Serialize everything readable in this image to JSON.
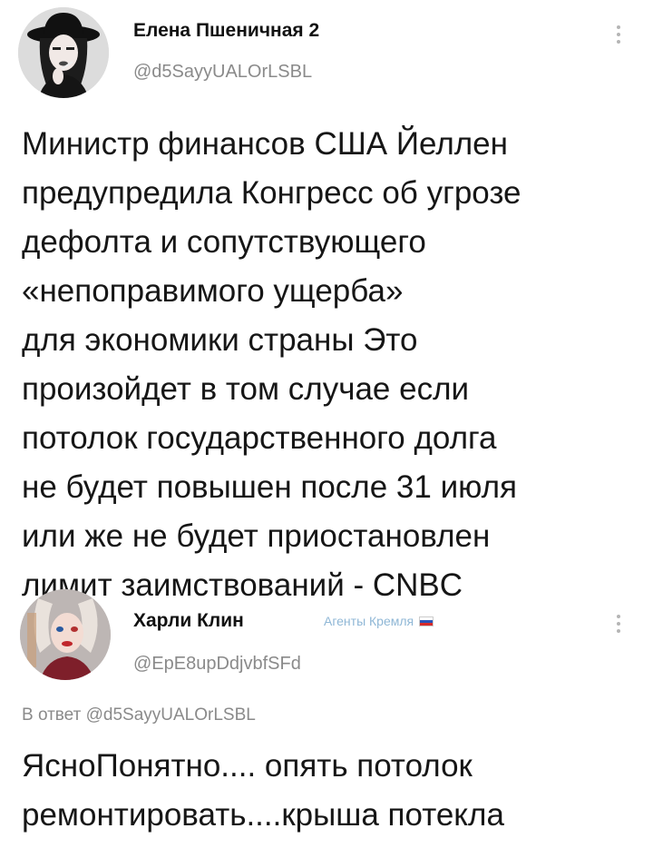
{
  "posts": [
    {
      "author_name": "Елена Пшеничная 2",
      "handle": "@d5SayyUALOrLSBL",
      "avatar_icon": "avatar-woman-hat-icon",
      "more_icon": "more-vertical-icon",
      "text": "Министр финансов США Йеллен\nпредупредила Конгресс об угрозе\nдефолта и сопутствующего\n«непоправимого ущерба»\nдля экономики страны Это\nпроизойдет в том случае если\nпотолок государственного долга\nне будет повышен после 31 июля\nили же не будет приостановлен\nлимит заимствований - CNBC"
    },
    {
      "author_name": "Харли Клин",
      "handle": "@EpE8upDdjvbfSFd",
      "badge": "Агенты Кремля",
      "badge_flag": "russia-flag-icon",
      "avatar_icon": "avatar-harley-icon",
      "more_icon": "more-vertical-icon",
      "reply_prefix": "В ответ",
      "reply_mention": "@d5SayyUALOrLSBL",
      "text": "ЯсноПонятно.... опять потолок\nремонтировать....крыша потекла"
    }
  ],
  "colors": {
    "background": "#ffffff",
    "text": "#161616",
    "muted": "#8a8a8a",
    "badge": "#8fb7d6"
  }
}
